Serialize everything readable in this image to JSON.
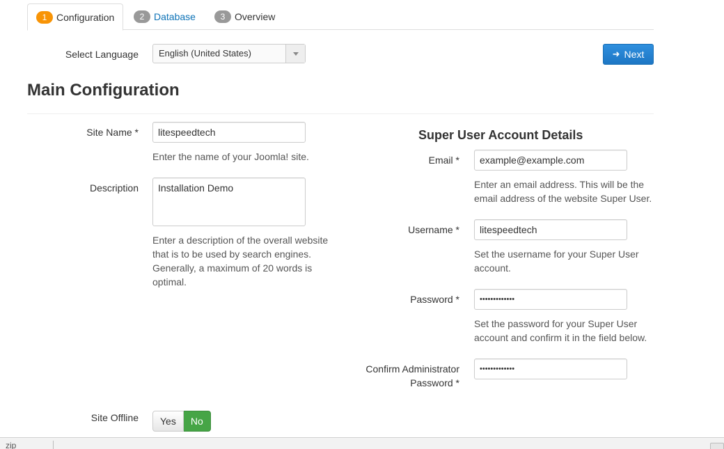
{
  "tabs": [
    {
      "num": "1",
      "label": "Configuration",
      "active": true
    },
    {
      "num": "2",
      "label": "Database",
      "active": false
    },
    {
      "num": "3",
      "label": "Overview",
      "active": false
    }
  ],
  "language": {
    "label": "Select Language",
    "value": "English (United States)"
  },
  "next_button": {
    "label": "Next",
    "icon": "arrow-right-icon"
  },
  "main_title": "Main Configuration",
  "site_name": {
    "label": "Site Name *",
    "value": "litespeedtech",
    "help": "Enter the name of your Joomla! site."
  },
  "description": {
    "label": "Description",
    "value": "Installation Demo",
    "help_lines": [
      "Enter a description of the overall website",
      "that is to be used by search engines.",
      "Generally, a maximum of 20 words is",
      "optimal."
    ]
  },
  "super_user": {
    "title": "Super User Account Details",
    "email": {
      "label": "Email *",
      "value": "example@example.com",
      "help_lines": [
        "Enter an email address. This will be the",
        "email address of the website Super User."
      ]
    },
    "username": {
      "label": "Username *",
      "value": "litespeedtech",
      "help_lines": [
        "Set the username for your Super User",
        "account."
      ]
    },
    "password": {
      "label": "Password *",
      "value": "•••••••••••••",
      "help_lines": [
        "Set the password for your Super User",
        "account and confirm it in the field below."
      ]
    },
    "confirm_password": {
      "label_lines": [
        "Confirm Administrator",
        "Password *"
      ],
      "value": "•••••••••••••"
    }
  },
  "site_offline": {
    "label": "Site Offline",
    "yes": "Yes",
    "no": "No",
    "selected": "No"
  },
  "bottom_bar": {
    "text": "zip"
  },
  "colors": {
    "accent": "#2384d3",
    "active_tab_badge": "#f89406",
    "inactive_badge": "#999999",
    "toggle_on": "#46a546",
    "link": "#0e73b7"
  }
}
